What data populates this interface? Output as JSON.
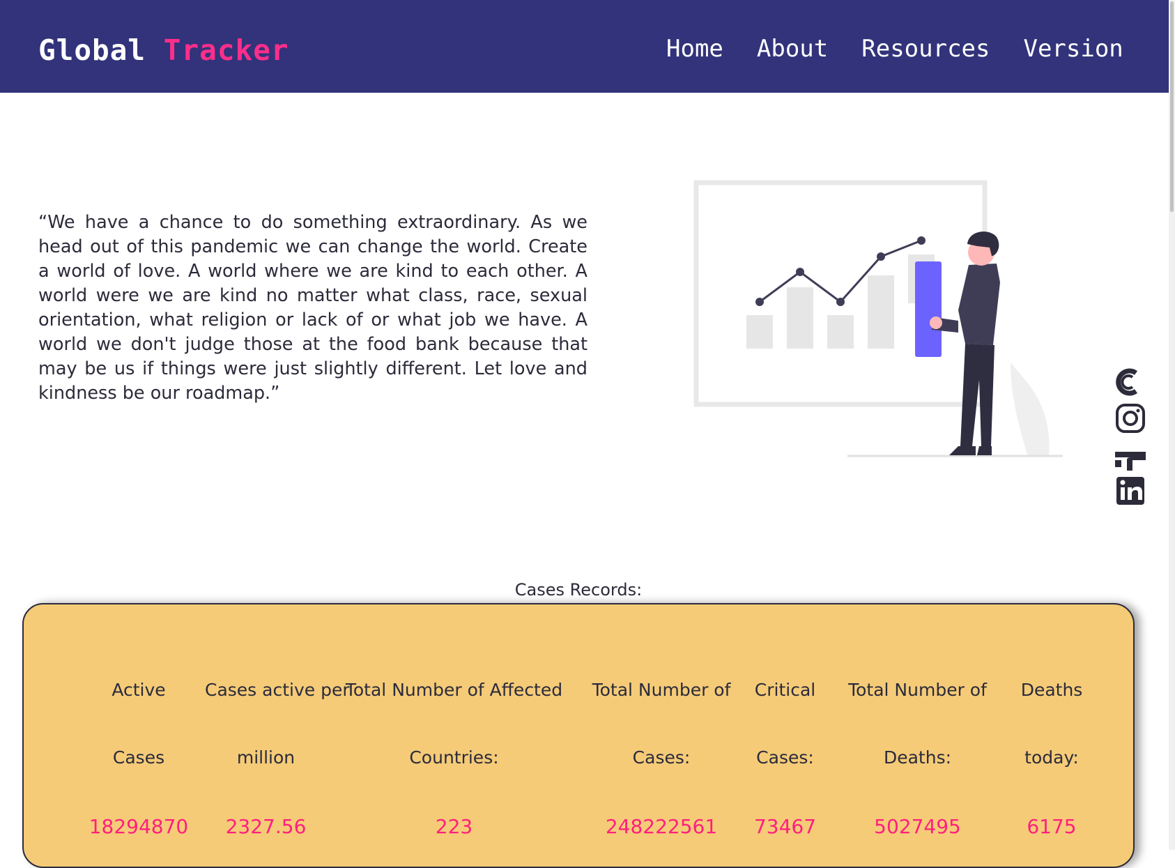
{
  "brand": {
    "word1": "Global",
    "word2": "Tracker"
  },
  "nav": {
    "items": [
      "Home",
      "About",
      "Resources",
      "Version"
    ]
  },
  "quote": {
    "text": "“We have a chance to do something extraordinary. As we head out of this pandemic we can change the world. Create a world of love. A world where we are kind to each other. A world were we are kind no matter what class, race, sexual orientation, what religion or lack of or what job we have. A world we don't judge those at the food bank because that may be us if things were just slightly different. Let love and kindness be our roadmap.”"
  },
  "illustration": {
    "icon": "person-with-chart-illustration",
    "accent_color": "#6c63ff"
  },
  "social": {
    "icons": [
      "codepen-icon",
      "instagram-icon",
      "facebook-icon",
      "linkedin-icon"
    ]
  },
  "records": {
    "title": "Cases Records:",
    "stats": [
      {
        "label_line1": "Active",
        "label_line2": "Cases",
        "value": "18294870"
      },
      {
        "label_line1": "Cases active per",
        "label_line2": "million",
        "value": "2327.56"
      },
      {
        "label_line1": "Total Number of Affected",
        "label_line2": "Countries:",
        "value": "223"
      },
      {
        "label_line1": "Total Number of",
        "label_line2": "Cases:",
        "value": "248222561"
      },
      {
        "label_line1": "Critical",
        "label_line2": "Cases:",
        "value": "73467"
      },
      {
        "label_line1": "Total Number of",
        "label_line2": "Deaths:",
        "value": "5027495"
      },
      {
        "label_line1": "Deaths",
        "label_line2": "today:",
        "value": "6175"
      }
    ]
  },
  "colors": {
    "navbar": "#32337a",
    "brand_accent": "#ff2e8a",
    "card_background": "#f5cb78",
    "stat_value": "#ff1f7e"
  }
}
